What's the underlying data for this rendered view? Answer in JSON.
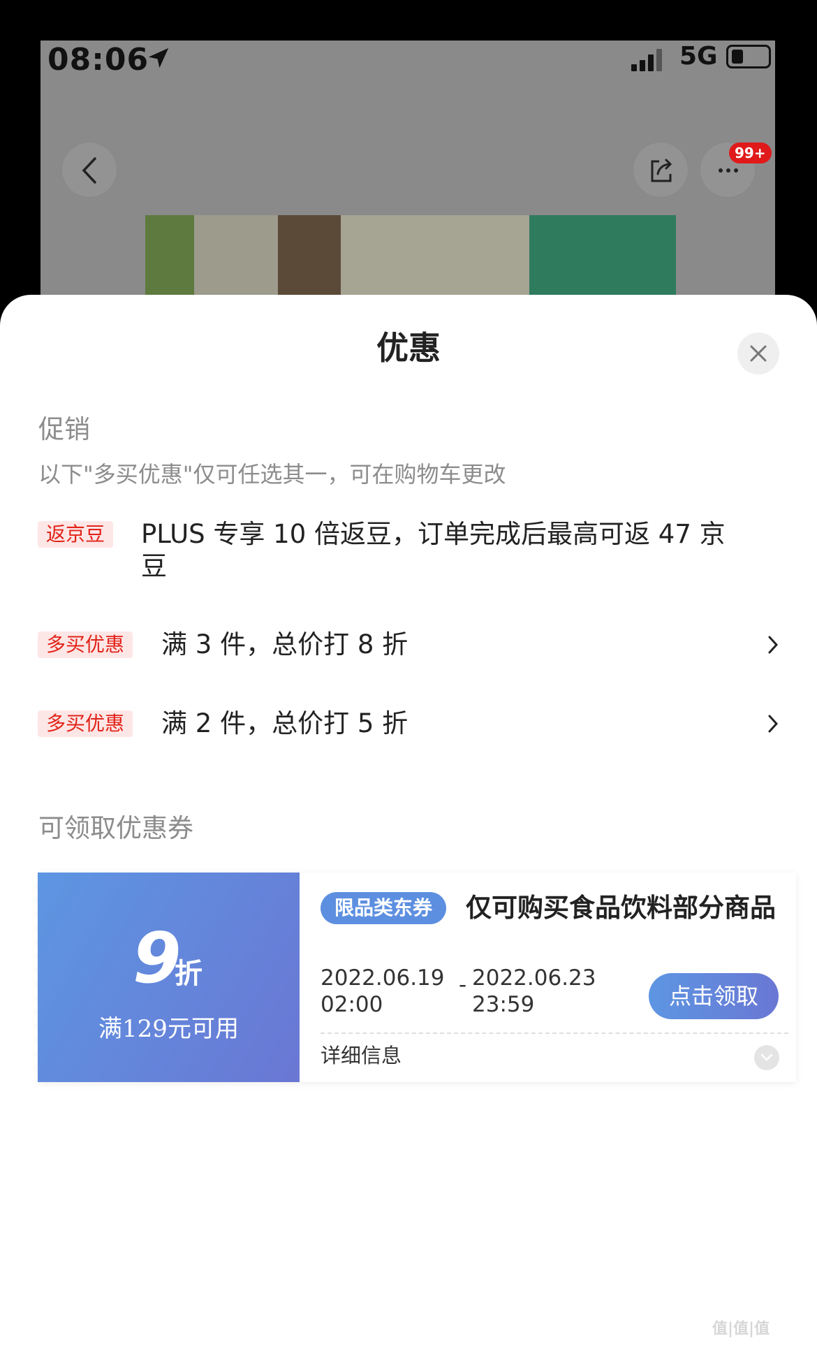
{
  "status_bar": {
    "time": "08:06",
    "network": "5G"
  },
  "background": {
    "more_badge": "99+"
  },
  "sheet": {
    "title": "优惠",
    "promo_section": {
      "title": "促销",
      "note": "以下\"多买优惠\"仅可任选其一，可在购物车更改",
      "items": [
        {
          "tag": "返京豆",
          "line1": "PLUS 专享 10 倍返豆，订单完成后最高可返 47 京",
          "line2": "豆"
        },
        {
          "tag": "多买优惠",
          "text": "满 3 件，总价打 8 折"
        },
        {
          "tag": "多买优惠",
          "text": "满 2 件，总价打 5 折"
        }
      ]
    },
    "coupon_section": {
      "title": "可领取优惠券",
      "coupon": {
        "discount_number": "9",
        "discount_unit": "折",
        "condition": "满129元可用",
        "category_tag": "限品类东券",
        "description": "仅可购买食品饮料部分商品",
        "start_date": "2022.06.19",
        "start_time": "02:00",
        "separator": "-",
        "end_date": "2022.06.23",
        "end_time": "23:59",
        "claim_label": "点击领取",
        "detail_label": "详细信息"
      }
    }
  },
  "watermark": "值|值|值",
  "colors": {
    "tag_red": "#e2231a",
    "tag_bg": "#fde7e6",
    "coupon_blue": "#5d96e2",
    "coupon_purple": "#6a77d4"
  }
}
